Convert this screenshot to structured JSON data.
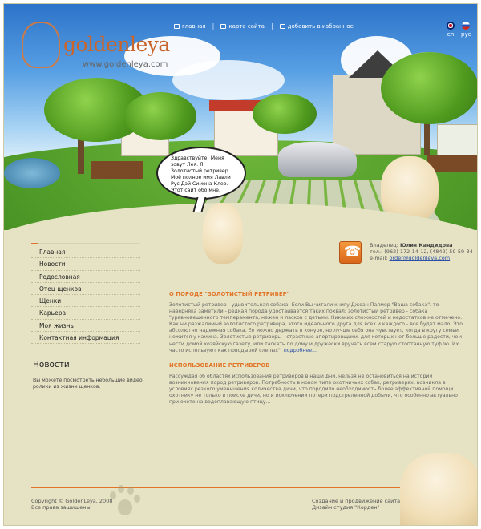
{
  "site": {
    "logo_text": "goldenleya",
    "logo_url": "www.goldenleya.com"
  },
  "topnav": {
    "items": [
      {
        "label": "главная",
        "icon": "home-icon"
      },
      {
        "label": "карта сайта",
        "icon": "sitemap-icon"
      },
      {
        "label": "добавить в избранное",
        "icon": "favorites-icon"
      }
    ]
  },
  "languages": [
    {
      "code": "en",
      "label": "en",
      "flag": "uk-flag-icon"
    },
    {
      "code": "ru",
      "label": "рус",
      "flag": "russia-flag-icon"
    }
  ],
  "bubble": {
    "text": "Здравствуйте! Меня зовут Лея. Я Золотистый ретривер. Моё полное имя Лавли Рус Дэй Симона Клео. Этот сайт обо мне."
  },
  "menu": {
    "items": [
      "Главная",
      "Новости",
      "Родословная",
      "Отец щенков",
      "Щенки",
      "Карьера",
      "Моя жизнь",
      "Контактная информация"
    ]
  },
  "news": {
    "title": "Новости",
    "text": "Вы можете посмотреть небольшие видео ролики из жизни щенков."
  },
  "contact": {
    "owner_label": "Владелец:",
    "owner_name": "Юлия Кандидова",
    "phone_label": "тел.:",
    "phone": "(962) 172-14-12, (4842) 59-59-34",
    "email_label": "e-mail:",
    "email": "order@goldenleya.com"
  },
  "main": {
    "section1_title": "О ПОРОДЕ \"ЗОЛОТИСТЫЙ РЕТРИВЕР\"",
    "section1_text": "Золотистый ретривер - удивительная собака! Если Вы читали книгу Джоан Палмер \"Ваша собака\", то наверняка заметили - редкая порода удостаивается таких похвал: золотистый ретривер - собака \"уравновешенного темперамента, нежен и ласков с детьми. Никаких сложностей и недостатков не отмечено. Как ни разжалимый золотистого ретривера, этого идеального друга для всех и каждого - все будет мало. Это абсолютно надежная собака. Ее можно держать в конуре, но лучше себя она чувствует, когда в кругу семьи нежится у камина. Золотистые ретриверы - страстные апортировщики, для которых нет больше радости, чем нести домой хозяйскую газету, или таскать по дому и дружески вручать всем старую стоптанную туфлю. Их часто используют как поводырей слепых\".",
    "more_link": "подробнее...",
    "section2_title": "ИСПОЛЬЗОВАНИЕ РЕТРИВЕРОВ",
    "section2_text": "Рассуждая об областях использования ретриверов в наши дни, нельзя не остановиться на истории возникновения пород ретриверов. Потребность в новом типе охотничьих собак, ретриверах, возникла в условиях резкого уменьшения количества дичи, что породило необходимость более эффективной помощи охотнику не только в поиске дичи, но и исключении потери подстреленной добычи, что особенно актуально при охоте на водоплавающую птицу..."
  },
  "footer": {
    "copyright": "Copyright © GoldenLeya, 2008",
    "rights": "Все права защищены.",
    "studio_line1": "Создание и продвижение сайта -",
    "studio_line2": "Дизайн студия \"Корден\""
  },
  "colors": {
    "accent": "#e1762a",
    "background": "#e6e3c4",
    "link": "#2b50a5"
  }
}
